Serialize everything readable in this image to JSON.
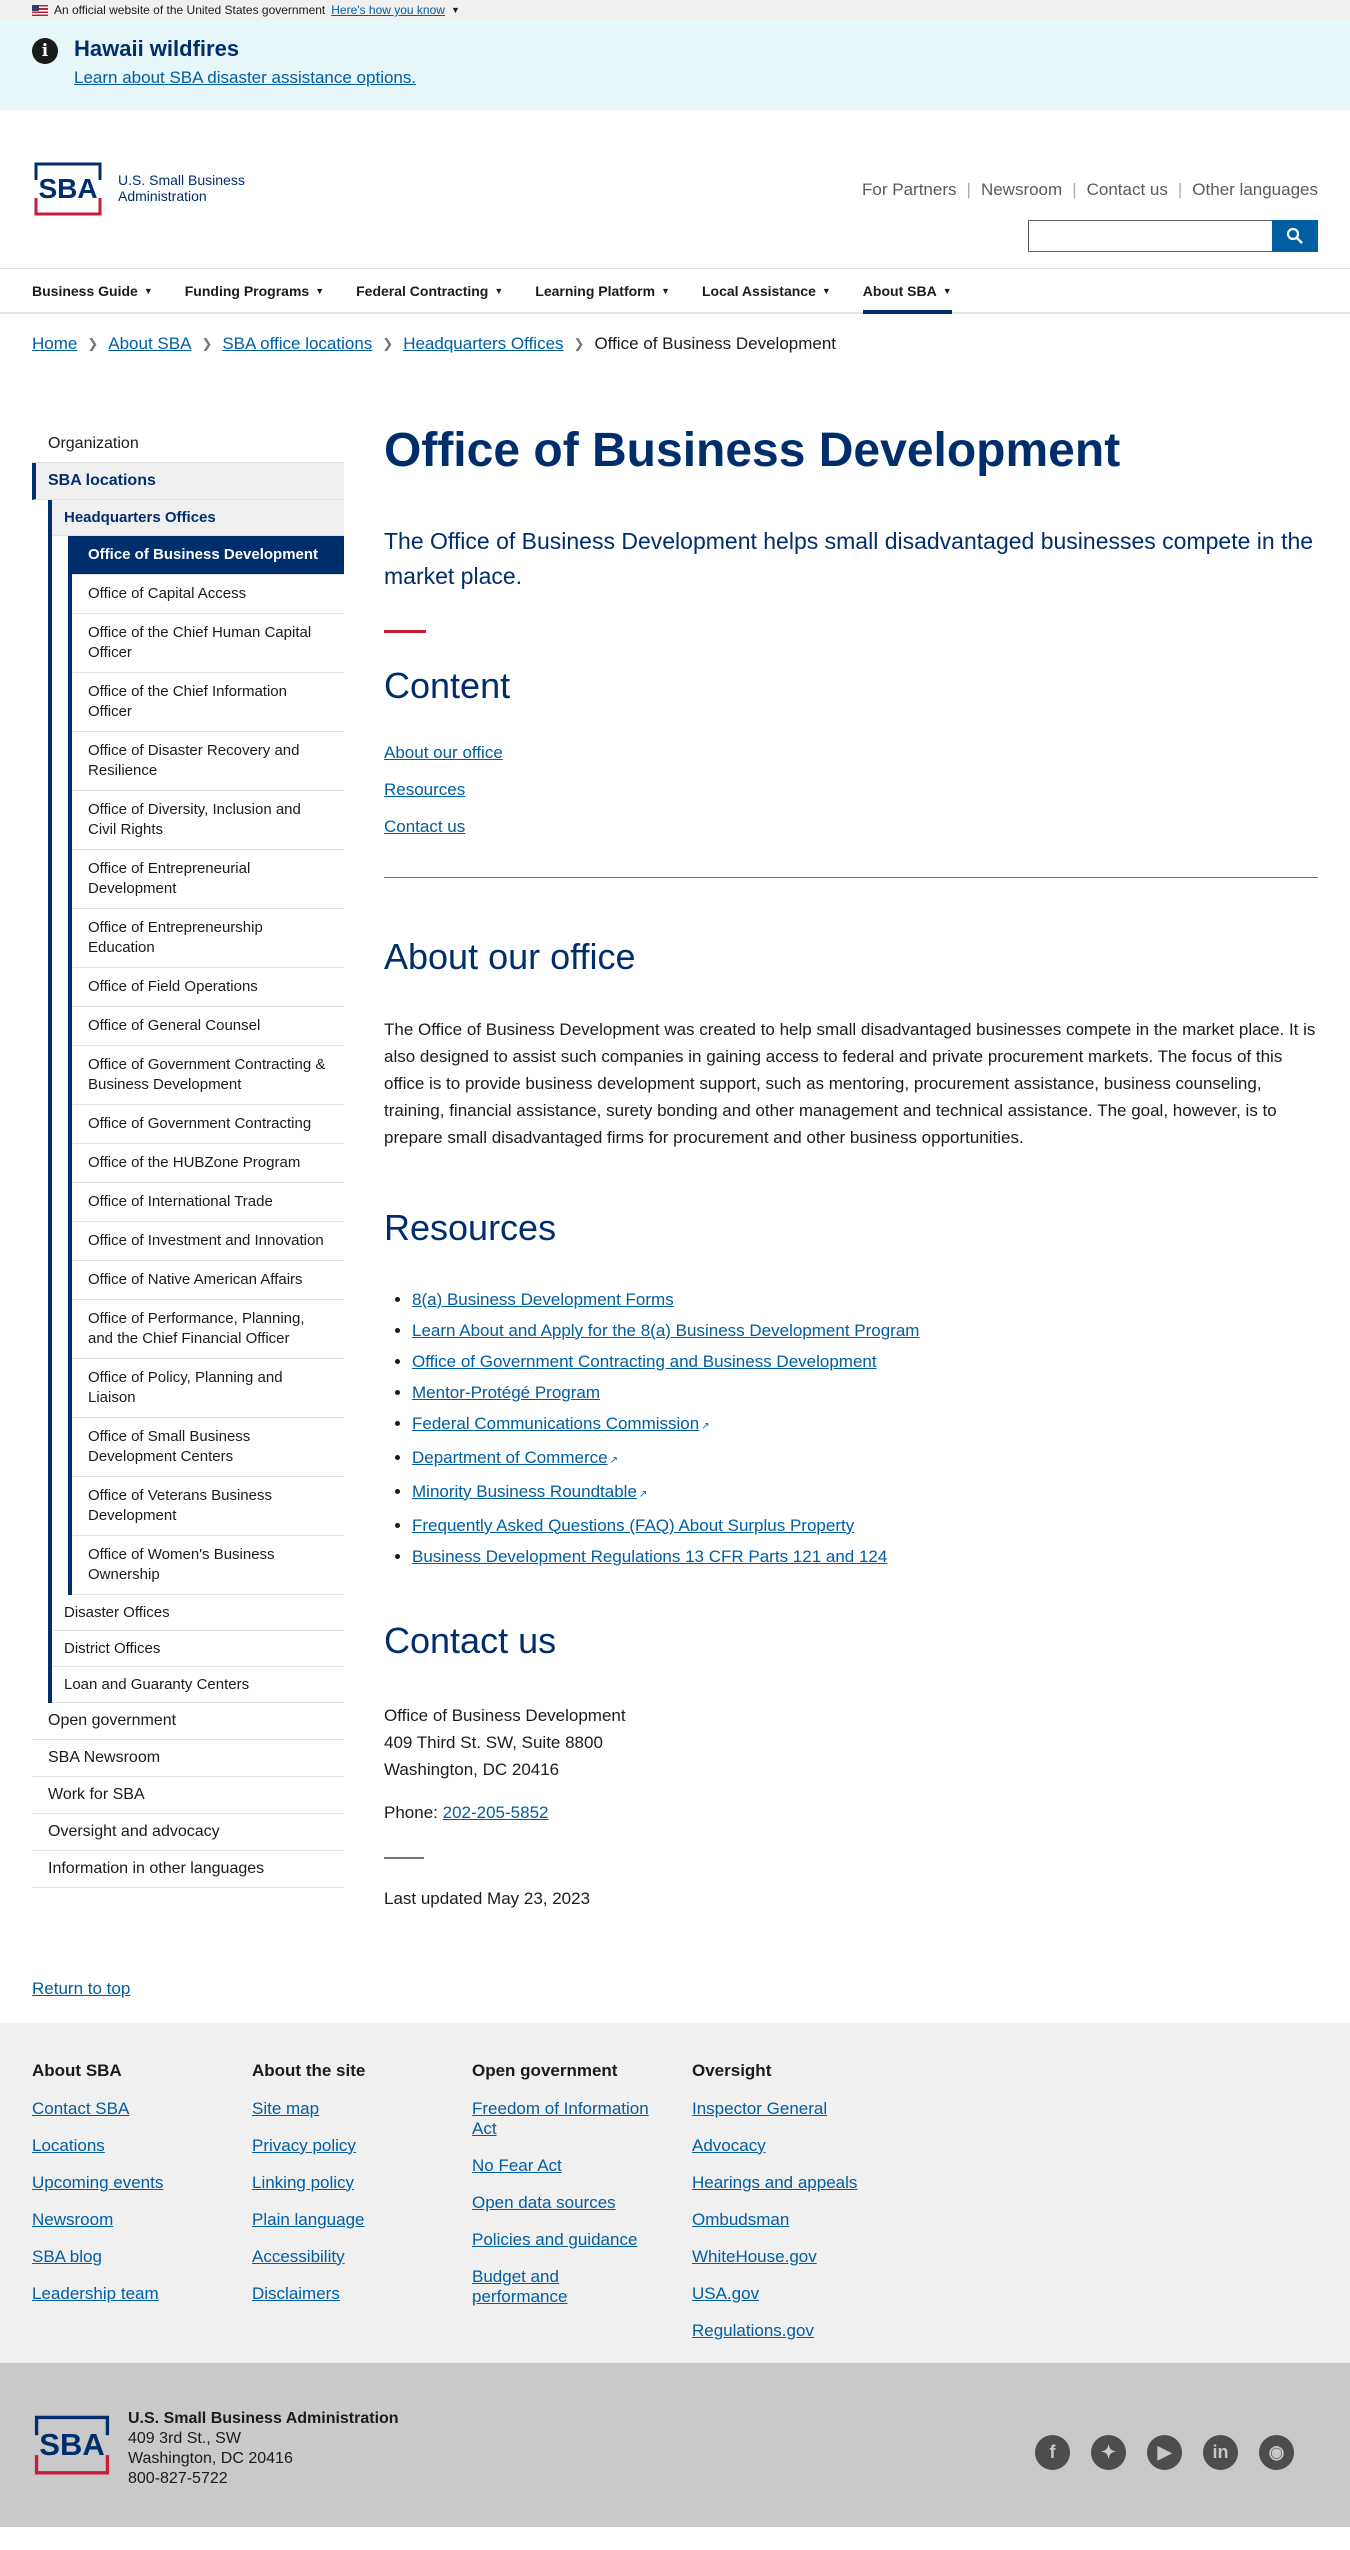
{
  "gov_banner": {
    "text": "An official website of the United States government",
    "link": "Here's how you know"
  },
  "alert": {
    "title": "Hawaii wildfires",
    "link": "Learn about SBA disaster assistance options."
  },
  "header": {
    "logo_text_1": "U.S. Small Business",
    "logo_text_2": "Administration",
    "utility": [
      "For Partners",
      "Newsroom",
      "Contact us",
      "Other languages"
    ]
  },
  "nav": [
    "Business Guide",
    "Funding Programs",
    "Federal Contracting",
    "Learning Platform",
    "Local Assistance",
    "About SBA"
  ],
  "breadcrumb": [
    "Home",
    "About SBA",
    "SBA office locations",
    "Headquarters Offices",
    "Office of Business Development"
  ],
  "sidenav": {
    "top": [
      "Organization",
      "SBA locations"
    ],
    "hq": "Headquarters Offices",
    "offices": [
      "Office of Business Development",
      "Office of Capital Access",
      "Office of the Chief Human Capital Officer",
      "Office of the Chief Information Officer",
      "Office of Disaster Recovery and Resilience",
      "Office of Diversity, Inclusion and Civil Rights",
      "Office of Entrepreneurial Development",
      "Office of Entrepreneurship Education",
      "Office of Field Operations",
      "Office of General Counsel",
      "Office of Government Contracting & Business Development",
      "Office of Government Contracting",
      "Office of the HUBZone Program",
      "Office of International Trade",
      "Office of Investment and Innovation",
      "Office of Native American Affairs",
      "Office of Performance, Planning, and the Chief Financial Officer",
      "Office of Policy, Planning and Liaison",
      "Office of Small Business Development Centers",
      "Office of Veterans Business Development",
      "Office of Women's Business Ownership"
    ],
    "level2": [
      "Disaster Offices",
      "District Offices",
      "Loan and Guaranty Centers"
    ],
    "bottom": [
      "Open government",
      "SBA Newsroom",
      "Work for SBA",
      "Oversight and advocacy",
      "Information in other languages"
    ]
  },
  "content": {
    "title": "Office of Business Development",
    "lede": "The Office of Business Development helps small disadvantaged businesses compete in the market place.",
    "toc_heading": "Content",
    "toc": [
      "About our office",
      "Resources",
      "Contact us"
    ],
    "about_heading": "About our office",
    "about_text": "The Office of Business Development was created to help small disadvantaged businesses compete in the market place. It is also designed to assist such companies in gaining access to federal and private procurement markets. The focus of this office is to provide business development support, such as mentoring, procurement assistance, business counseling, training, financial assistance, surety bonding and other management and technical assistance. The goal, however, is to prepare small disadvantaged firms for procurement and other business opportunities.",
    "resources_heading": "Resources",
    "resources": [
      "8(a) Business Development Forms",
      "Learn About and Apply for the 8(a) Business Development Program",
      "Office of Government Contracting and Business Development",
      "Mentor-Protégé Program",
      "Federal Communications Commission",
      "Department of Commerce",
      "Minority Business Roundtable",
      "Frequently Asked Questions (FAQ) About Surplus Property",
      "Business Development Regulations 13 CFR Parts 121 and 124"
    ],
    "contact_heading": "Contact us",
    "contact_lines": [
      "Office of Business Development",
      "409 Third St. SW, Suite 8800",
      "Washington, DC 20416"
    ],
    "phone_label": "Phone:",
    "phone": "202-205-5852",
    "updated": "Last updated May 23, 2023"
  },
  "return_top": "Return to top",
  "footer": {
    "cols": [
      {
        "heading": "About SBA",
        "links": [
          "Contact SBA",
          "Locations",
          "Upcoming events",
          "Newsroom",
          "SBA blog",
          "Leadership team"
        ]
      },
      {
        "heading": "About the site",
        "links": [
          "Site map",
          "Privacy policy",
          "Linking policy",
          "Plain language",
          "Accessibility",
          "Disclaimers"
        ]
      },
      {
        "heading": "Open government",
        "links": [
          "Freedom of Information Act",
          "No Fear Act",
          "Open data sources",
          "Policies and guidance",
          "Budget and performance"
        ]
      },
      {
        "heading": "Oversight",
        "links": [
          "Inspector General",
          "Advocacy",
          "Hearings and appeals",
          "Ombudsman",
          "WhiteHouse.gov",
          "USA.gov",
          "Regulations.gov"
        ]
      }
    ],
    "org": "U.S. Small Business Administration",
    "address": [
      "409 3rd St., SW",
      "Washington, DC 20416",
      "800-827-5722"
    ],
    "social": [
      "facebook-icon",
      "twitter-icon",
      "youtube-icon",
      "linkedin-icon",
      "instagram-icon"
    ]
  },
  "colors": {
    "navy": "#002e6d",
    "link": "#005ea2",
    "red": "#c41e3a"
  }
}
